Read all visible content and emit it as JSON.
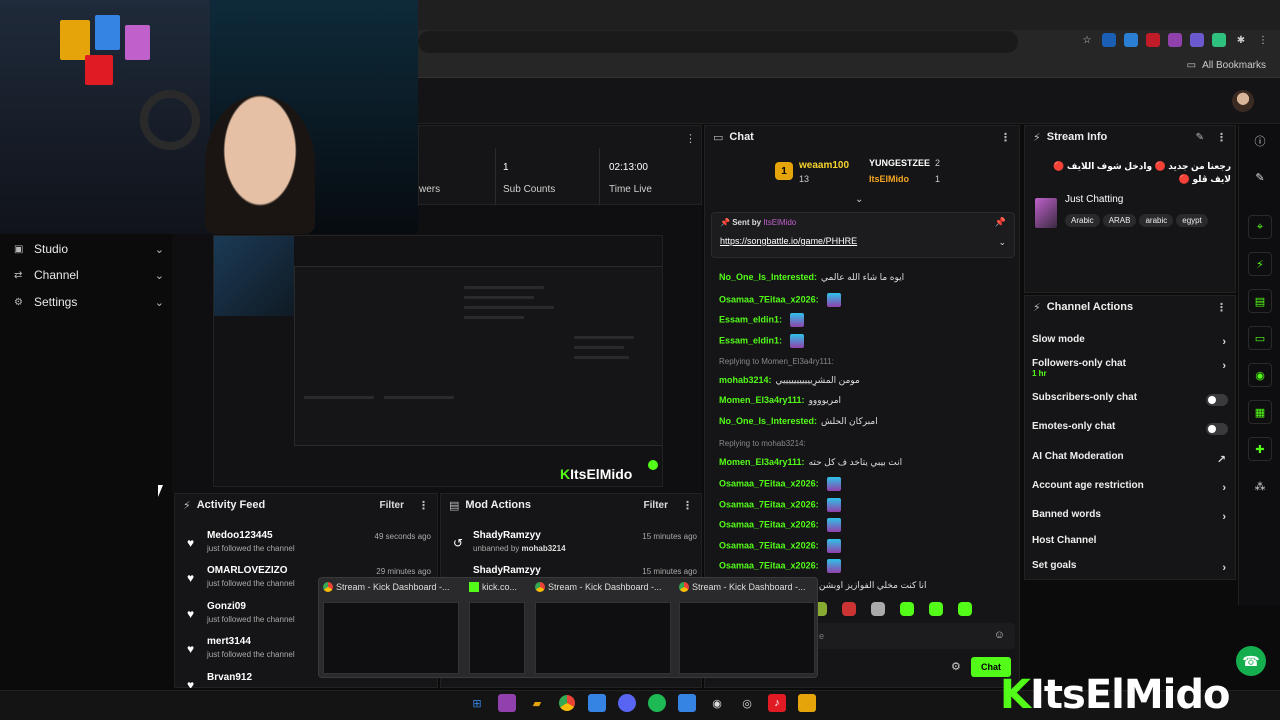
{
  "browser": {
    "bookmarks_label": "All Bookmarks"
  },
  "sidebar": {
    "items": [
      {
        "label": "Studio"
      },
      {
        "label": "Channel"
      },
      {
        "label": "Settings"
      }
    ]
  },
  "stats": {
    "viewers_label": "wers",
    "sub_counts_value": "1",
    "sub_counts_label": "Sub Counts",
    "time_live_value": "02:13:00",
    "time_live_label": "Time Live"
  },
  "preview": {
    "watermark": "ItsElMido"
  },
  "activity_feed": {
    "title": "Activity Feed",
    "filter": "Filter",
    "items": [
      {
        "name": "Medoo123445",
        "sub": "just followed the channel",
        "time": "49 seconds ago"
      },
      {
        "name": "OMARLOVEZIZO",
        "sub": "just followed the channel",
        "time": "29 minutes ago"
      },
      {
        "name": "Gonzi09",
        "sub": "just followed the channel",
        "time": ""
      },
      {
        "name": "mert3144",
        "sub": "just followed the channel",
        "time": ""
      },
      {
        "name": "Brvan912",
        "sub": "",
        "time": ""
      }
    ]
  },
  "mod_actions": {
    "title": "Mod Actions",
    "filter": "Filter",
    "items": [
      {
        "name": "ShadyRamzyy",
        "sub": "unbanned by",
        "by": "mohab3214",
        "time": "15 minutes ago"
      },
      {
        "name": "ShadyRamzyy",
        "sub": "",
        "by": "",
        "time": "15 minutes ago"
      }
    ]
  },
  "chat": {
    "title": "Chat",
    "leaders": [
      {
        "rank": "1",
        "name": "weaam100",
        "count": "13"
      },
      {
        "rank": "",
        "name": "YUNGESTZEE",
        "count": "2"
      },
      {
        "rank": "",
        "name": "ItsElMido",
        "count": "1"
      }
    ],
    "pinned": {
      "sent_by_label": "Sent by",
      "sent_by_user": "ItsElMido",
      "link": "https://songbattle.io/game/PHHRE"
    },
    "messages": [
      {
        "user": "No_One_Is_Interested:",
        "text": "ايوه ما شاء الله عالمي"
      },
      {
        "user": "Osamaa_7Eitaa_x2026:",
        "text": ""
      },
      {
        "user": "Essam_eldin1:",
        "text": ""
      },
      {
        "user": "Essam_eldin1:",
        "text": ""
      },
      {
        "reply": "Replying to Momen_El3a4ry111:"
      },
      {
        "user": "mohab3214:",
        "text": "مومن المشرٍيييييييييييي"
      },
      {
        "user": "Momen_El3a4ry111:",
        "text": "امريوووو"
      },
      {
        "user": "No_One_Is_Interested:",
        "text": "امبركان الحلش"
      },
      {
        "reply": "Replying to mohab3214:"
      },
      {
        "user": "Momen_El3a4ry111:",
        "text": "انت بيبي يتاخد ف كل حته"
      },
      {
        "user": "Osamaa_7Eitaa_x2026:",
        "text": ""
      },
      {
        "user": "Osamaa_7Eitaa_x2026:",
        "text": ""
      },
      {
        "user": "Osamaa_7Eitaa_x2026:",
        "text": ""
      },
      {
        "user": "Osamaa_7Eitaa_x2026:",
        "text": ""
      },
      {
        "user": "Osamaa_7Eitaa_x2026:",
        "text": ""
      },
      {
        "user": "mohab3214:",
        "text": "انا كنت مخلي الفوازيز اوبشن ساعة الله؟"
      }
    ],
    "send_label": "Chat",
    "input_placeholder": "e"
  },
  "stream_info": {
    "title": "Stream Info",
    "stream_title": "رجعنا من جديد 🔴 وادخل شوف اللايف 🔴 لايف ڤلو 🔴",
    "category": "Just Chatting",
    "tags": [
      "Arabic",
      "ARAB",
      "arabic",
      "egypt"
    ]
  },
  "channel_actions": {
    "title": "Channel Actions",
    "items": [
      {
        "label": "Slow mode",
        "sub": ""
      },
      {
        "label": "Followers-only chat",
        "sub": "1 hr"
      },
      {
        "label": "Subscribers-only chat",
        "sub": ""
      },
      {
        "label": "Emotes-only chat",
        "sub": ""
      },
      {
        "label": "AI Chat Moderation",
        "sub": ""
      },
      {
        "label": "Account age restriction",
        "sub": ""
      },
      {
        "label": "Banned words",
        "sub": ""
      },
      {
        "label": "Host Channel",
        "sub": ""
      },
      {
        "label": "Set goals",
        "sub": ""
      }
    ]
  },
  "taskbar_thumbs": [
    {
      "title": "Stream - Kick Dashboard -..."
    },
    {
      "title": "kick.co..."
    },
    {
      "title": "Stream - Kick Dashboard -..."
    },
    {
      "title": "Stream - Kick Dashboard -..."
    }
  ],
  "brand": {
    "k": "K",
    "rest": "ItsElMido"
  },
  "colors": {
    "accent": "#53fc18",
    "panel": "#151517",
    "background": "#0b0b0c"
  }
}
